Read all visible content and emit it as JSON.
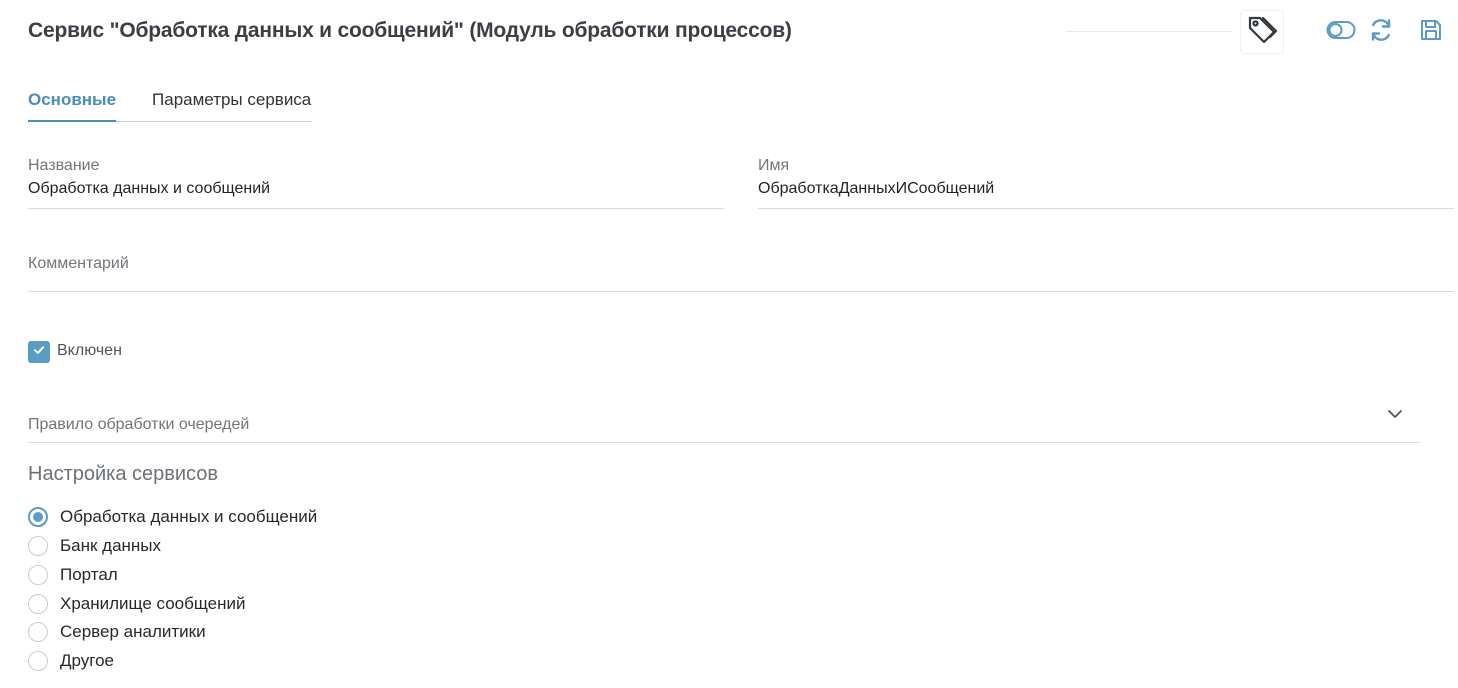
{
  "header": {
    "title": "Сервис \"Обработка данных и сообщений\" (Модуль обработки процессов)"
  },
  "toolbar": {
    "tag_icon": "tag-icon",
    "toggle_icon": "toggle-icon",
    "refresh_icon": "refresh-icon",
    "save_icon": "save-icon",
    "accent_color": "#5b9cc4"
  },
  "tabs": [
    {
      "label": "Основные",
      "active": true
    },
    {
      "label": "Параметры сервиса",
      "active": false
    }
  ],
  "fields": {
    "name": {
      "label": "Название",
      "value": "Обработка данных и сообщений"
    },
    "id_name": {
      "label": "Имя",
      "value": "ОбработкаДанныхИСообщений"
    },
    "comment": {
      "label": "Комментарий",
      "value": ""
    },
    "enabled": {
      "label": "Включен",
      "checked": true
    },
    "queue_rule": {
      "label": "Правило обработки очередей",
      "value": ""
    }
  },
  "services": {
    "title": "Настройка сервисов",
    "selected_index": 0,
    "options": [
      "Обработка данных и сообщений",
      "Банк данных",
      "Портал",
      "Хранилище сообщений",
      "Сервер аналитики",
      "Другое"
    ]
  }
}
